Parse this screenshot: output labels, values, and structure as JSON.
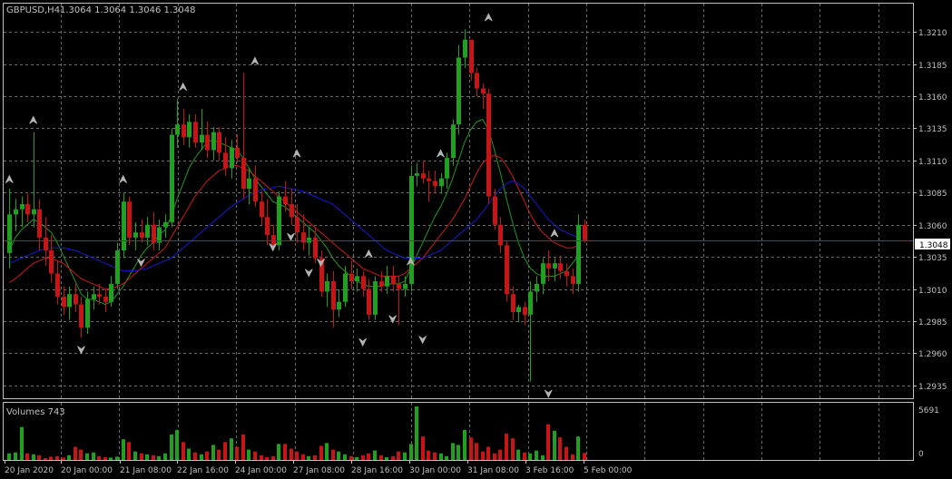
{
  "chart_header": {
    "symbol_timeframe": "GBPUSD,H4",
    "ohlc": "1.3064 1.3064 1.3046 1.3048"
  },
  "colors": {
    "background": "#000000",
    "grid": "#6b6b6b",
    "frame": "#c0c0c0",
    "text": "#c0c0c0",
    "bull": "#1fa01f",
    "bear": "#c81414",
    "ma_fast": "#1f9a1f",
    "ma_mid": "#d01818",
    "ma_slow": "#1818d8",
    "price_line": "#c81414",
    "fractal": "#b4b4b4"
  },
  "chart_data": {
    "type": "candlestick",
    "price_axis": {
      "ticks": [
        "1.3210",
        "1.3185",
        "1.3160",
        "1.3135",
        "1.3110",
        "1.3085",
        "1.3060",
        "1.3035",
        "1.3010",
        "1.2985",
        "1.2960",
        "1.2935"
      ],
      "range": [
        1.2925,
        1.3232
      ],
      "current_price": "1.3048"
    },
    "time_axis": {
      "labels": [
        "20 Jan 2020",
        "20 Jan 00:00",
        "21 Jan 08:00",
        "22 Jan 16:00",
        "24 Jan 00:00",
        "27 Jan 08:00",
        "28 Jan 16:00",
        "30 Jan 00:00",
        "31 Jan 08:00",
        "3 Feb 16:00",
        "5 Feb 00:00"
      ]
    },
    "candles": [
      [
        1.3038,
        1.3088,
        1.3026,
        1.3068
      ],
      [
        1.3068,
        1.308,
        1.3055,
        1.3072
      ],
      [
        1.3072,
        1.3082,
        1.3058,
        1.3076
      ],
      [
        1.3076,
        1.3084,
        1.3062,
        1.3068
      ],
      [
        1.3068,
        1.3132,
        1.3058,
        1.3072
      ],
      [
        1.3072,
        1.308,
        1.304,
        1.305
      ],
      [
        1.305,
        1.3066,
        1.3028,
        1.304
      ],
      [
        1.304,
        1.3052,
        1.3015,
        1.3022
      ],
      [
        1.3022,
        1.3032,
        1.2998,
        1.3004
      ],
      [
        1.3004,
        1.3012,
        1.299,
        1.2996
      ],
      [
        1.2996,
        1.3012,
        1.2986,
        1.3006
      ],
      [
        1.3006,
        1.3014,
        1.2992,
        1.2998
      ],
      [
        1.2998,
        1.3004,
        1.2972,
        1.298
      ],
      [
        1.298,
        1.3008,
        1.2975,
        1.3002
      ],
      [
        1.3002,
        1.3012,
        1.2994,
        1.3006
      ],
      [
        1.3006,
        1.3014,
        1.2998,
        1.3004
      ],
      [
        1.3004,
        1.301,
        1.2992,
        1.3
      ],
      [
        1.3,
        1.302,
        1.2996,
        1.3014
      ],
      [
        1.3014,
        1.3046,
        1.301,
        1.304
      ],
      [
        1.304,
        1.3085,
        1.3034,
        1.3078
      ],
      [
        1.3078,
        1.3082,
        1.3044,
        1.305
      ],
      [
        1.305,
        1.3062,
        1.304,
        1.3054
      ],
      [
        1.3054,
        1.3064,
        1.3046,
        1.305
      ],
      [
        1.305,
        1.3066,
        1.3044,
        1.306
      ],
      [
        1.306,
        1.307,
        1.304,
        1.3046
      ],
      [
        1.3046,
        1.3064,
        1.304,
        1.3058
      ],
      [
        1.3058,
        1.3068,
        1.305,
        1.3062
      ],
      [
        1.3062,
        1.3135,
        1.3058,
        1.313
      ],
      [
        1.313,
        1.3158,
        1.312,
        1.3138
      ],
      [
        1.3138,
        1.315,
        1.3122,
        1.3128
      ],
      [
        1.3128,
        1.3146,
        1.312,
        1.314
      ],
      [
        1.314,
        1.3146,
        1.312,
        1.3124
      ],
      [
        1.3124,
        1.315,
        1.3118,
        1.313
      ],
      [
        1.313,
        1.314,
        1.3112,
        1.3118
      ],
      [
        1.3118,
        1.3136,
        1.311,
        1.3132
      ],
      [
        1.3132,
        1.3136,
        1.311,
        1.3116
      ],
      [
        1.3116,
        1.3128,
        1.3098,
        1.3104
      ],
      [
        1.3104,
        1.3126,
        1.3096,
        1.312
      ],
      [
        1.312,
        1.313,
        1.3108,
        1.3112
      ],
      [
        1.3112,
        1.3178,
        1.308,
        1.3088
      ],
      [
        1.3088,
        1.3104,
        1.3076,
        1.3096
      ],
      [
        1.3096,
        1.3106,
        1.3074,
        1.3078
      ],
      [
        1.3078,
        1.3086,
        1.306,
        1.3066
      ],
      [
        1.3066,
        1.308,
        1.3044,
        1.3052
      ],
      [
        1.3052,
        1.306,
        1.304,
        1.3044
      ],
      [
        1.3044,
        1.3086,
        1.304,
        1.3082
      ],
      [
        1.3082,
        1.3094,
        1.307,
        1.3076
      ],
      [
        1.3076,
        1.3088,
        1.306,
        1.3066
      ],
      [
        1.3066,
        1.3076,
        1.3046,
        1.3054
      ],
      [
        1.3054,
        1.3068,
        1.304,
        1.3046
      ],
      [
        1.3046,
        1.3058,
        1.3036,
        1.305
      ],
      [
        1.305,
        1.3058,
        1.303,
        1.3034
      ],
      [
        1.3034,
        1.304,
        1.3004,
        1.3008
      ],
      [
        1.3008,
        1.3022,
        1.2996,
        1.3016
      ],
      [
        1.3016,
        1.3024,
        1.298,
        1.2994
      ],
      [
        1.2994,
        1.301,
        1.2988,
        1.3
      ],
      [
        1.3,
        1.3028,
        1.2996,
        1.3022
      ],
      [
        1.3022,
        1.3032,
        1.301,
        1.3016
      ],
      [
        1.3016,
        1.3026,
        1.3008,
        1.302
      ],
      [
        1.302,
        1.3024,
        1.3004,
        1.301
      ],
      [
        1.301,
        1.3018,
        1.2986,
        1.299
      ],
      [
        1.299,
        1.302,
        1.2986,
        1.3016
      ],
      [
        1.3016,
        1.3024,
        1.3008,
        1.3012
      ],
      [
        1.3012,
        1.3028,
        1.3006,
        1.302
      ],
      [
        1.302,
        1.3028,
        1.3008,
        1.3014
      ],
      [
        1.3014,
        1.302,
        1.2982,
        1.301
      ],
      [
        1.301,
        1.302,
        1.3004,
        1.3014
      ],
      [
        1.3014,
        1.3106,
        1.3008,
        1.3098
      ],
      [
        1.3098,
        1.3108,
        1.309,
        1.31
      ],
      [
        1.31,
        1.311,
        1.3092,
        1.3096
      ],
      [
        1.3096,
        1.3102,
        1.3078,
        1.3094
      ],
      [
        1.3094,
        1.3102,
        1.3084,
        1.309
      ],
      [
        1.309,
        1.31,
        1.3084,
        1.3096
      ],
      [
        1.3096,
        1.3116,
        1.3088,
        1.3112
      ],
      [
        1.3112,
        1.3142,
        1.3106,
        1.3138
      ],
      [
        1.3138,
        1.32,
        1.313,
        1.319
      ],
      [
        1.319,
        1.3212,
        1.3182,
        1.3204
      ],
      [
        1.3204,
        1.3186,
        1.3172,
        1.3178
      ],
      [
        1.3178,
        1.3182,
        1.316,
        1.3166
      ],
      [
        1.3166,
        1.317,
        1.315,
        1.3162
      ],
      [
        1.3162,
        1.3166,
        1.3076,
        1.3082
      ],
      [
        1.3082,
        1.3088,
        1.3056,
        1.306
      ],
      [
        1.306,
        1.3066,
        1.3038,
        1.3044
      ],
      [
        1.3044,
        1.3048,
        1.3,
        1.3006
      ],
      [
        1.3006,
        1.3012,
        1.2986,
        1.2992
      ],
      [
        1.2992,
        1.2998,
        1.2984,
        1.2996
      ],
      [
        1.2996,
        1.3,
        1.2982,
        1.299
      ],
      [
        1.299,
        1.3016,
        1.2938,
        1.3008
      ],
      [
        1.3008,
        1.302,
        1.3,
        1.3014
      ],
      [
        1.3014,
        1.3034,
        1.3006,
        1.303
      ],
      [
        1.303,
        1.304,
        1.3016,
        1.3026
      ],
      [
        1.3026,
        1.3034,
        1.3016,
        1.303
      ],
      [
        1.303,
        1.3036,
        1.3018,
        1.3024
      ],
      [
        1.3024,
        1.303,
        1.3012,
        1.302
      ],
      [
        1.302,
        1.3026,
        1.3006,
        1.3014
      ],
      [
        1.3014,
        1.3068,
        1.3008,
        1.306
      ],
      [
        1.306,
        1.3064,
        1.3046,
        1.3048
      ]
    ],
    "moving_averages": [
      {
        "period": 8,
        "color": "#1f9a1f",
        "values": [
          1.304,
          1.305,
          1.3056,
          1.306,
          1.3064,
          1.3062,
          1.3058,
          1.3054,
          1.3046,
          1.3036,
          1.3026,
          1.3016,
          1.3006,
          1.3002,
          1.3002,
          1.3,
          1.2998,
          1.3,
          1.3006,
          1.3012,
          1.302,
          1.3028,
          1.3036,
          1.3042,
          1.3046,
          1.3052,
          1.3056,
          1.3066,
          1.308,
          1.3092,
          1.3104,
          1.3112,
          1.3118,
          1.3124,
          1.3126,
          1.3124,
          1.3122,
          1.312,
          1.3118,
          1.3112,
          1.3104,
          1.3096,
          1.309,
          1.3084,
          1.3078,
          1.3076,
          1.3074,
          1.307,
          1.3066,
          1.3062,
          1.3058,
          1.3054,
          1.3048,
          1.3042,
          1.3034,
          1.3028,
          1.3024,
          1.302,
          1.3016,
          1.3014,
          1.3012,
          1.3012,
          1.3012,
          1.3014,
          1.3014,
          1.3014,
          1.3016,
          1.3026,
          1.3036,
          1.3046,
          1.3056,
          1.3066,
          1.3074,
          1.3084,
          1.3096,
          1.311,
          1.3124,
          1.3134,
          1.314,
          1.3142,
          1.3134,
          1.3118,
          1.31,
          1.308,
          1.3062,
          1.3046,
          1.3034,
          1.3026,
          1.3022,
          1.302,
          1.302,
          1.302,
          1.3022,
          1.3024,
          1.303,
          1.3036
        ]
      },
      {
        "period": 21,
        "color": "#d01818",
        "values": [
          1.3015,
          1.3018,
          1.3022,
          1.3026,
          1.303,
          1.3032,
          1.3034,
          1.3034,
          1.3032,
          1.303,
          1.3026,
          1.3022,
          1.3018,
          1.3016,
          1.3014,
          1.3012,
          1.301,
          1.301,
          1.3012,
          1.3014,
          1.3018,
          1.3022,
          1.3026,
          1.303,
          1.3034,
          1.3038,
          1.3042,
          1.305,
          1.3058,
          1.3066,
          1.3074,
          1.3082,
          1.3088,
          1.3094,
          1.3098,
          1.3102,
          1.3104,
          1.3106,
          1.3106,
          1.3104,
          1.3102,
          1.3098,
          1.3094,
          1.309,
          1.3086,
          1.3082,
          1.3078,
          1.3074,
          1.307,
          1.3066,
          1.3062,
          1.3058,
          1.3054,
          1.305,
          1.3046,
          1.3042,
          1.3038,
          1.3034,
          1.303,
          1.3026,
          1.3024,
          1.3022,
          1.302,
          1.302,
          1.302,
          1.302,
          1.3022,
          1.3026,
          1.303,
          1.3034,
          1.304,
          1.3046,
          1.3052,
          1.3058,
          1.3064,
          1.3072,
          1.308,
          1.309,
          1.31,
          1.3108,
          1.3112,
          1.3114,
          1.3112,
          1.3106,
          1.3098,
          1.3088,
          1.3078,
          1.3068,
          1.306,
          1.3054,
          1.305,
          1.3046,
          1.3044,
          1.3042,
          1.3042,
          1.3044
        ]
      },
      {
        "period": 50,
        "color": "#1818d8",
        "values": [
          1.303,
          1.3032,
          1.3034,
          1.3036,
          1.3038,
          1.304,
          1.3041,
          1.3042,
          1.3042,
          1.3042,
          1.3041,
          1.304,
          1.3038,
          1.3036,
          1.3034,
          1.3032,
          1.303,
          1.3028,
          1.3026,
          1.3024,
          1.3024,
          1.3024,
          1.3025,
          1.3026,
          1.3028,
          1.303,
          1.3032,
          1.3034,
          1.3038,
          1.3042,
          1.3046,
          1.305,
          1.3054,
          1.3058,
          1.3062,
          1.3066,
          1.307,
          1.3074,
          1.3077,
          1.308,
          1.3083,
          1.3085,
          1.3087,
          1.3088,
          1.3089,
          1.309,
          1.3089,
          1.3088,
          1.3087,
          1.3086,
          1.3084,
          1.3082,
          1.308,
          1.3078,
          1.3076,
          1.3072,
          1.3068,
          1.3064,
          1.306,
          1.3056,
          1.3052,
          1.3048,
          1.3044,
          1.304,
          1.3038,
          1.3036,
          1.3034,
          1.3034,
          1.3034,
          1.3034,
          1.3036,
          1.3038,
          1.304,
          1.3044,
          1.3048,
          1.3052,
          1.3056,
          1.306,
          1.3064,
          1.307,
          1.3076,
          1.3082,
          1.3088,
          1.3092,
          1.3094,
          1.3092,
          1.3088,
          1.3082,
          1.3076,
          1.307,
          1.3064,
          1.306,
          1.3056,
          1.3054,
          1.3052,
          1.305
        ]
      }
    ],
    "fractals": [
      {
        "bar": 4,
        "dir": "up",
        "price": 1.314
      },
      {
        "bar": 12,
        "dir": "down",
        "price": 1.2964
      },
      {
        "bar": 29,
        "dir": "up",
        "price": 1.3166
      },
      {
        "bar": 41,
        "dir": "up",
        "price": 1.3186
      },
      {
        "bar": 47,
        "dir": "down",
        "price": 1.3052
      },
      {
        "bar": 48,
        "dir": "up",
        "price": 1.3114
      },
      {
        "bar": 50,
        "dir": "down",
        "price": 1.3024
      },
      {
        "bar": 52,
        "dir": "down",
        "price": 1.3032
      },
      {
        "bar": 59,
        "dir": "down",
        "price": 1.297
      },
      {
        "bar": 60,
        "dir": "up",
        "price": 1.3036
      },
      {
        "bar": 64,
        "dir": "down",
        "price": 1.2988
      },
      {
        "bar": 67,
        "dir": "up",
        "price": 1.303
      },
      {
        "bar": 69,
        "dir": "down",
        "price": 1.2972
      },
      {
        "bar": 72,
        "dir": "up",
        "price": 1.3114
      },
      {
        "bar": 80,
        "dir": "up",
        "price": 1.322
      },
      {
        "bar": 90,
        "dir": "down",
        "price": 1.293
      },
      {
        "bar": 91,
        "dir": "up",
        "price": 1.3052
      },
      {
        "bar": 0,
        "dir": "up",
        "price": 1.3094
      },
      {
        "bar": 19,
        "dir": "up",
        "price": 1.3094
      },
      {
        "bar": 22,
        "dir": "down",
        "price": 1.3032
      },
      {
        "bar": 44,
        "dir": "down",
        "price": 1.3044
      }
    ],
    "volumes": {
      "label": "Volumes 743",
      "axis_max_label": "5691",
      "axis_min_label": "0",
      "max": 5691,
      "values": [
        700,
        800,
        3500,
        700,
        600,
        500,
        200,
        350,
        400,
        250,
        500,
        1400,
        1100,
        700,
        800,
        400,
        300,
        250,
        350,
        2200,
        1900,
        900,
        700,
        600,
        500,
        400,
        700,
        2700,
        3200,
        1900,
        1200,
        800,
        600,
        900,
        1600,
        1100,
        1900,
        2300,
        1400,
        2700,
        1100,
        900,
        500,
        300,
        400,
        1700,
        1700,
        1200,
        900,
        600,
        400,
        500,
        1500,
        1800,
        1100,
        900,
        600,
        400,
        300,
        500,
        700,
        1000,
        500,
        300,
        400,
        900,
        800,
        1700,
        5691,
        2500,
        1000,
        800,
        700,
        400,
        1800,
        1600,
        3200,
        2400,
        1800,
        900,
        1400,
        700,
        1100,
        2800,
        2300,
        1100,
        800,
        700,
        1000,
        500,
        3800,
        3100,
        2400,
        1400,
        600,
        2500,
        743
      ]
    }
  }
}
